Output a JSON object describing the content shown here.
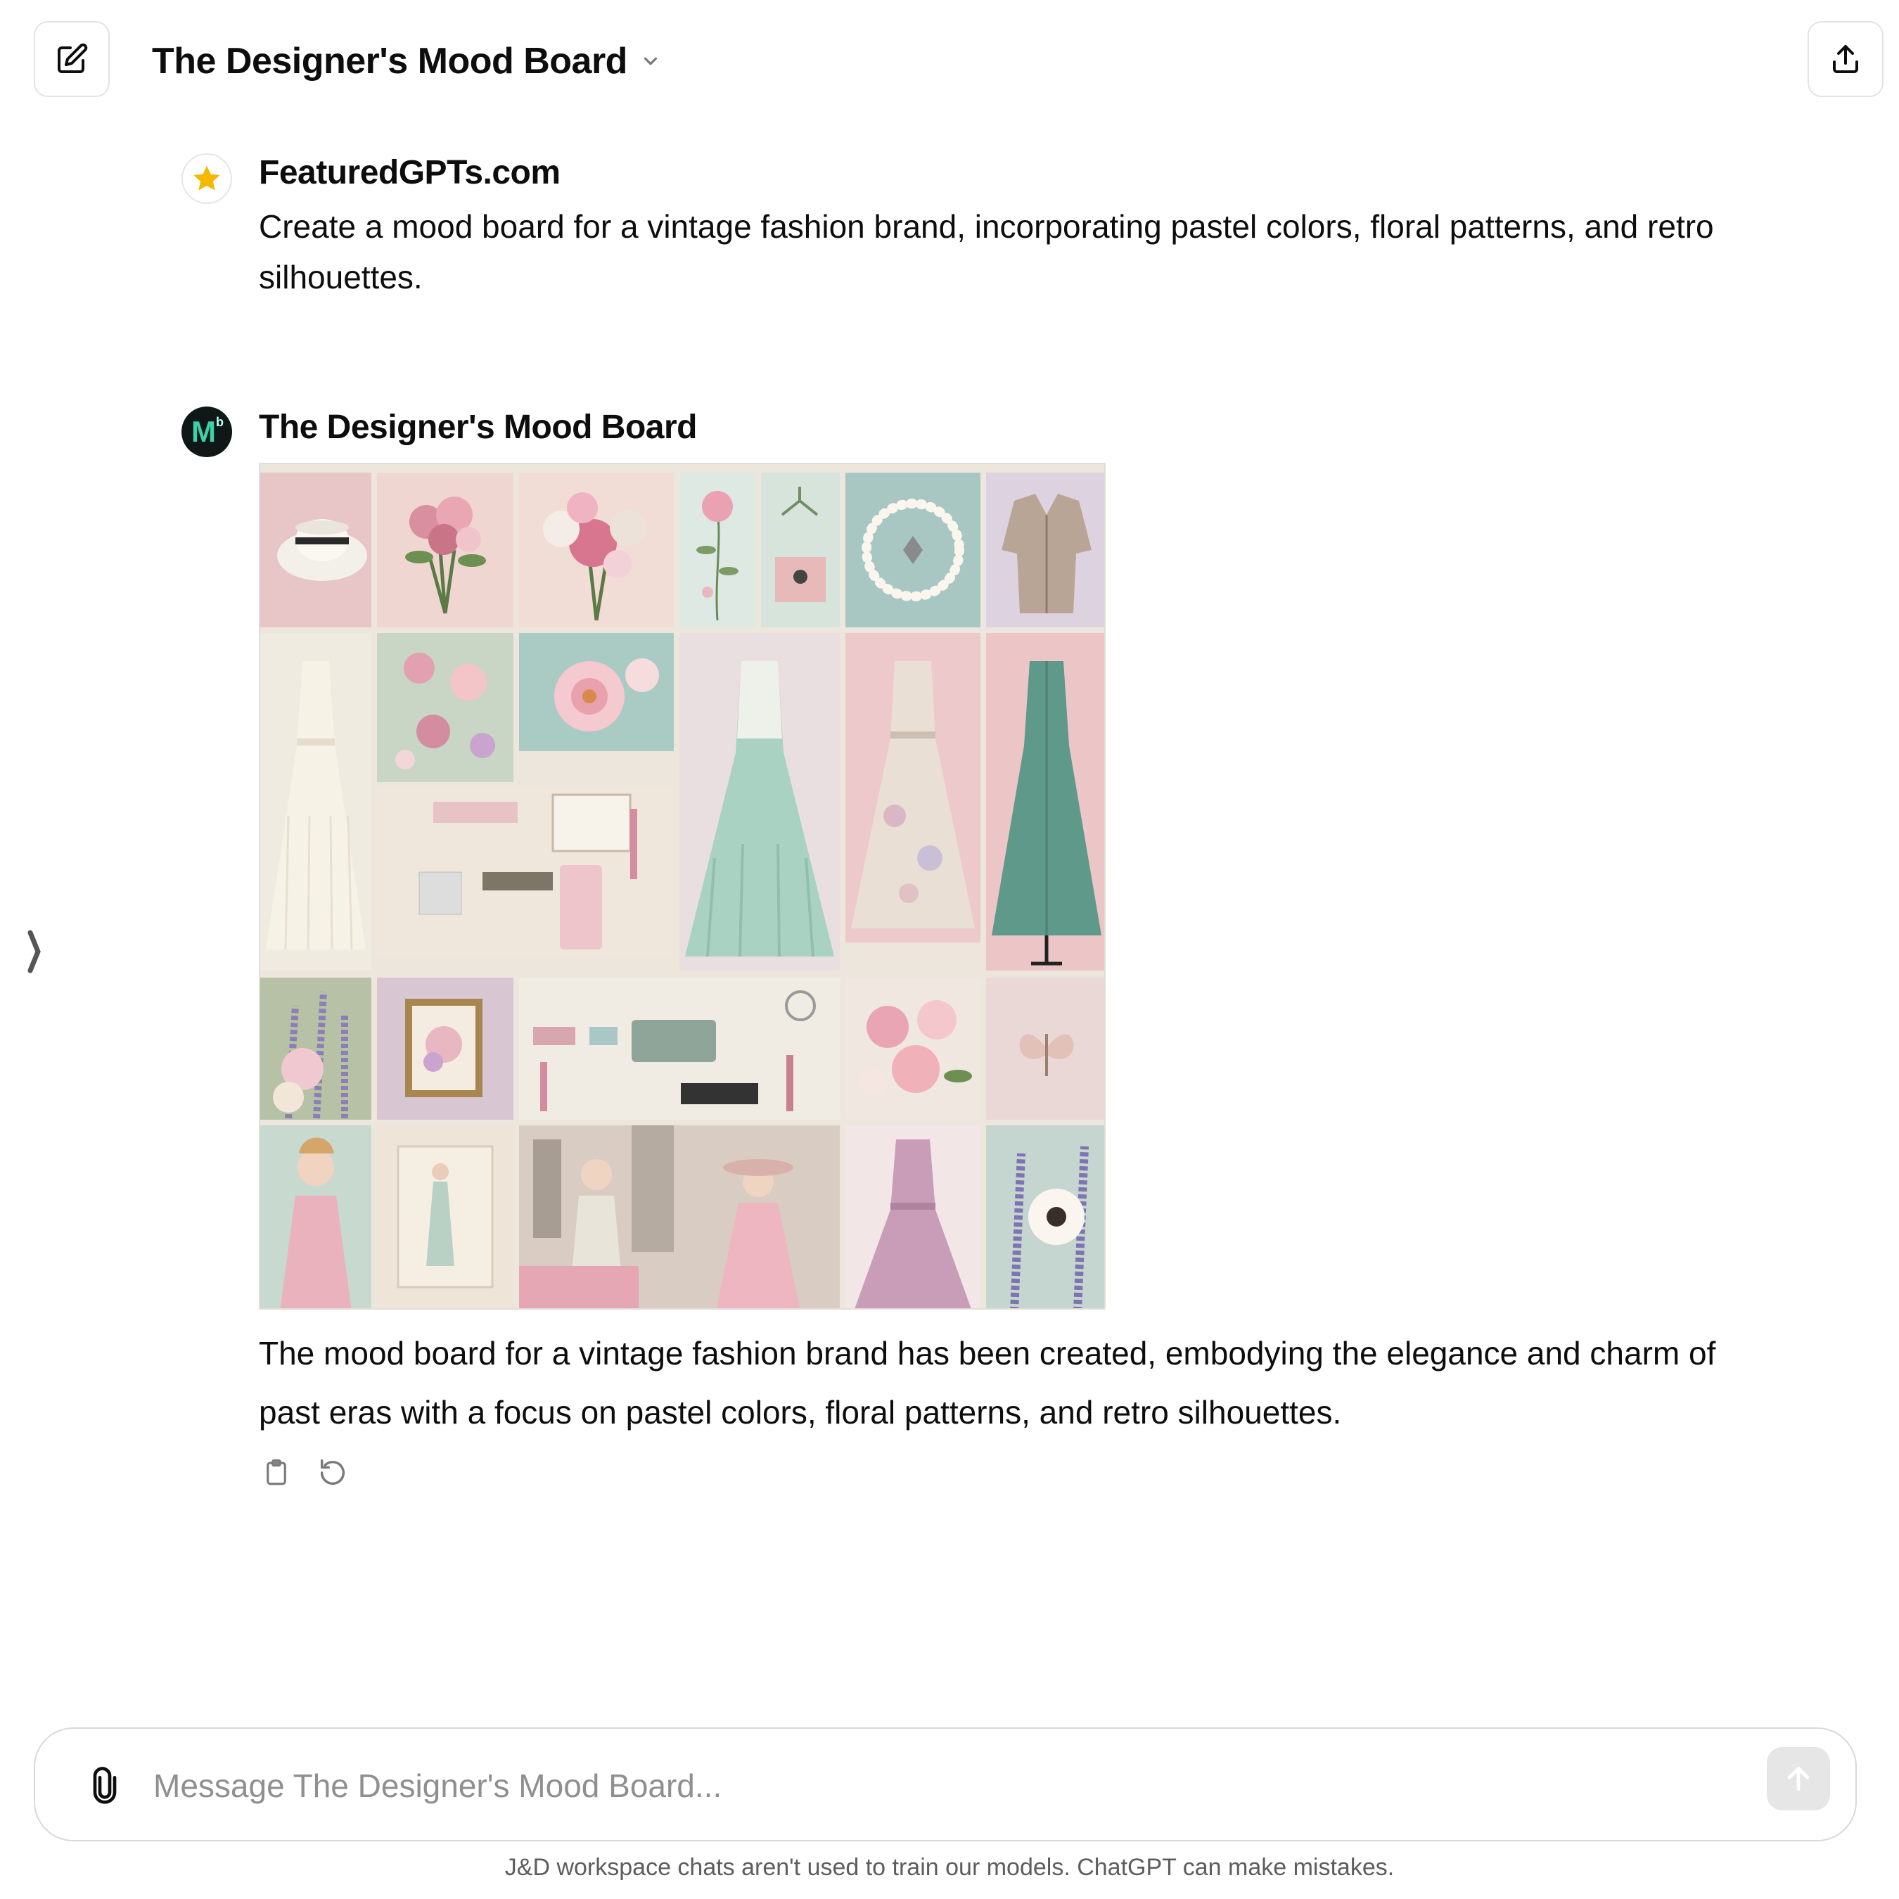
{
  "header": {
    "title": "The Designer's Mood Board",
    "new_chat_icon": "pencil-square-icon",
    "share_icon": "share-upload-icon",
    "dropdown_icon": "chevron-down-icon"
  },
  "conversation": {
    "user_message": {
      "sender": "FeaturedGPTs.com",
      "avatar_icon": "star-icon",
      "text": "Create a mood board for a vintage fashion brand, incorporating pastel colors, floral patterns, and retro silhouettes."
    },
    "assistant_message": {
      "sender": "The Designer's Mood Board",
      "avatar_letter": "M",
      "avatar_sup": "b",
      "image": {
        "tiles": [
          "hat",
          "bouquet-pink",
          "bouquet-rose",
          "botanical-sprig",
          "jewelry-box",
          "pearl-necklace",
          "tweed-jacket",
          "white-dress",
          "floral-print",
          "peony",
          "mint-gown",
          "lace-dress",
          "green-dress",
          "cosmetics-flatlay",
          "lavender-flowers",
          "framed-print",
          "rose-cluster",
          "butterfly",
          "pink-lady",
          "sketch-card",
          "city-women",
          "hat-lady",
          "lilac-dress",
          "daisy-lavender"
        ]
      },
      "text": "The mood board for a vintage fashion brand has been created, embodying the elegance and charm of past eras with a focus on pastel colors, floral patterns, and retro silhouettes.",
      "actions": [
        "clipboard-icon",
        "regenerate-icon"
      ]
    }
  },
  "sidebar": {
    "toggle_icon": "sidebar-toggle-icon"
  },
  "composer": {
    "placeholder": "Message The Designer's Mood Board...",
    "attach_icon": "paperclip-icon",
    "send_icon": "arrow-up-icon"
  },
  "footer": {
    "disclaimer": "J&D workspace chats aren't used to train our models. ChatGPT can make mistakes."
  },
  "colors": {
    "text": "#0d0d0d",
    "border": "#e3e3e3",
    "muted": "#8f8f8f",
    "gpt_avatar_bg": "#0f1717",
    "gpt_avatar_fg": "#3fd0a6",
    "star": "#f5b800"
  }
}
